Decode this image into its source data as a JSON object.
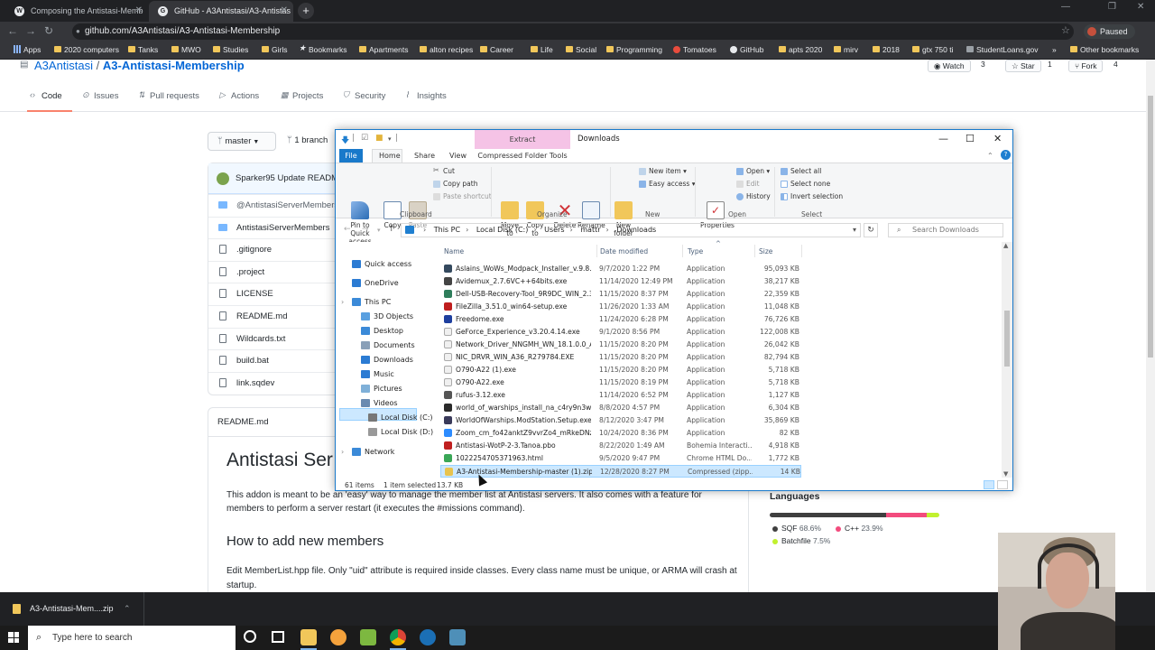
{
  "browser": {
    "tabs": [
      {
        "title": "Composing the Antistasi-Memb",
        "favicon": "W",
        "active": false
      },
      {
        "title": "GitHub - A3Antistasi/A3-Antistas",
        "favicon": "G",
        "active": true
      }
    ],
    "new_tab": "+",
    "url": "github.com/A3Antistasi/A3-Antistasi-Membership",
    "profile_status": "Paused",
    "bookmarks": [
      "Apps",
      "2020 computers",
      "Tanks",
      "MWO",
      "Studies",
      "Girls",
      "Bookmarks",
      "Apartments",
      "alton recipes",
      "Career",
      "Life",
      "Social",
      "Programming",
      "Tomatoes",
      "GitHub",
      "apts 2020",
      "mirv",
      "2018",
      "gtx 750 ti",
      "StudentLoans.gov"
    ],
    "bookmarks_more": "»",
    "other_bookmarks": "Other bookmarks"
  },
  "github": {
    "owner": "A3Antistasi",
    "separator": "/",
    "repo": "A3-Antistasi-Membership",
    "watch_label": "Watch",
    "watch_count": "3",
    "star_label": "Star",
    "star_count": "1",
    "fork_label": "Fork",
    "fork_count": "4",
    "tabs": [
      "Code",
      "Issues",
      "Pull requests",
      "Actions",
      "Projects",
      "Security",
      "Insights"
    ],
    "branch": "master",
    "branches": "1 branch",
    "commit": "Sparker95 Update READM",
    "files": [
      {
        "name": "@AntistasiServerMembers/",
        "type": "dir"
      },
      {
        "name": "AntistasiServerMembers",
        "type": "dir"
      },
      {
        "name": ".gitignore",
        "type": "file"
      },
      {
        "name": ".project",
        "type": "file"
      },
      {
        "name": "LICENSE",
        "type": "file"
      },
      {
        "name": "README.md",
        "type": "file"
      },
      {
        "name": "Wildcards.txt",
        "type": "file"
      },
      {
        "name": "build.bat",
        "type": "file"
      },
      {
        "name": "link.sqdev",
        "type": "file"
      }
    ],
    "readme": {
      "file": "README.md",
      "title": "Antistasi Ser",
      "intro": "This addon is meant to be an 'easy' way to manage the member list at Antistasi servers. It also comes with a feature for members to perform a server restart (it executes the #missions command).",
      "h2": "How to add new members",
      "p2": "Edit MemberList.hpp file. Only \"uid\" attribute is required inside classes. Every class name must be unique, or ARMA will crash at startup."
    },
    "languages": {
      "title": "Languages",
      "items": [
        {
          "name": "SQF",
          "percent": "68.6%",
          "value": 68.6,
          "color": "#3F3F3F"
        },
        {
          "name": "C++",
          "percent": "23.9%",
          "value": 23.9,
          "color": "#f34b7d"
        },
        {
          "name": "Batchfile",
          "percent": "7.5%",
          "value": 7.5,
          "color": "#C1F12E"
        }
      ]
    }
  },
  "explorer": {
    "title": "Downloads",
    "contextual_tab": "Extract",
    "ribbon_tabs": [
      "File",
      "Home",
      "Share",
      "View"
    ],
    "contextual_tab_label": "Compressed Folder Tools",
    "clipboard": {
      "pin": "Pin to Quick access",
      "copy": "Copy",
      "paste": "Paste",
      "cut": "Cut",
      "copy_path": "Copy path",
      "paste_shortcut": "Paste shortcut",
      "group": "Clipboard"
    },
    "organize": {
      "move_to": "Move to",
      "copy_to": "Copy to",
      "delete": "Delete",
      "rename": "Rename",
      "group": "Organize"
    },
    "new": {
      "new_folder": "New folder",
      "new_item": "New item",
      "easy_access": "Easy access",
      "group": "New"
    },
    "open": {
      "properties": "Properties",
      "open": "Open",
      "edit": "Edit",
      "history": "History",
      "group": "Open"
    },
    "select": {
      "select_all": "Select all",
      "select_none": "Select none",
      "invert": "Invert selection",
      "group": "Select"
    },
    "path": [
      "This PC",
      "Local Disk (C:)",
      "Users",
      "mattr",
      "Downloads"
    ],
    "search_placeholder": "Search Downloads",
    "nav": [
      {
        "label": "Quick access",
        "icon": "star-icon",
        "color": "#2b7bd3"
      },
      {
        "label": "OneDrive",
        "icon": "cloud-icon",
        "color": "#2b7bd3"
      },
      {
        "label": "This PC",
        "icon": "computer-icon",
        "color": "#3b8ad8"
      },
      {
        "label": "3D Objects",
        "icon": "cube-icon",
        "color": "#5aa0e0"
      },
      {
        "label": "Desktop",
        "icon": "desktop-icon",
        "color": "#3b8ad8"
      },
      {
        "label": "Documents",
        "icon": "documents-icon",
        "color": "#8aa0b8"
      },
      {
        "label": "Downloads",
        "icon": "download-icon",
        "color": "#2b7bd3"
      },
      {
        "label": "Music",
        "icon": "music-icon",
        "color": "#2b7bd3"
      },
      {
        "label": "Pictures",
        "icon": "pictures-icon",
        "color": "#7fb0d8"
      },
      {
        "label": "Videos",
        "icon": "videos-icon",
        "color": "#6a8ab0"
      },
      {
        "label": "Local Disk (C:)",
        "icon": "drive-icon",
        "color": "#777777"
      },
      {
        "label": "Local Disk (D:)",
        "icon": "drive-icon",
        "color": "#999999"
      },
      {
        "label": "Network",
        "icon": "network-icon",
        "color": "#3b8ad8"
      }
    ],
    "columns": [
      "Name",
      "Date modified",
      "Type",
      "Size"
    ],
    "files": [
      {
        "name": "Aslains_WoWs_Modpack_Installer_v.9.8.0...",
        "date": "9/7/2020 1:22 PM",
        "type": "Application",
        "size": "95,093 KB",
        "color": "#34495e"
      },
      {
        "name": "Avidemux_2.7.6VC++64bits.exe",
        "date": "11/14/2020 12:49 PM",
        "type": "Application",
        "size": "38,217 KB",
        "color": "#444444"
      },
      {
        "name": "Dell-USB-Recovery-Tool_9R9DC_WIN_2.3...",
        "date": "11/15/2020 8:37 PM",
        "type": "Application",
        "size": "22,359 KB",
        "color": "#2e7d5b"
      },
      {
        "name": "FileZilla_3.51.0_win64-setup.exe",
        "date": "11/26/2020 1:33 AM",
        "type": "Application",
        "size": "11,048 KB",
        "color": "#bf1e1e"
      },
      {
        "name": "Freedome.exe",
        "date": "11/24/2020 6:28 PM",
        "type": "Application",
        "size": "76,726 KB",
        "color": "#1e3f9e"
      },
      {
        "name": "GeForce_Experience_v3.20.4.14.exe",
        "date": "9/1/2020 8:56 PM",
        "type": "Application",
        "size": "122,008 KB",
        "color": "#f0f0f0"
      },
      {
        "name": "Network_Driver_NNGMH_WN_18.1.0.0_A...",
        "date": "11/15/2020 8:20 PM",
        "type": "Application",
        "size": "26,042 KB",
        "color": "#f0f0f0"
      },
      {
        "name": "NIC_DRVR_WIN_A36_R279784.EXE",
        "date": "11/15/2020 8:20 PM",
        "type": "Application",
        "size": "82,794 KB",
        "color": "#f0f0f0"
      },
      {
        "name": "O790-A22 (1).exe",
        "date": "11/15/2020 8:20 PM",
        "type": "Application",
        "size": "5,718 KB",
        "color": "#f0f0f0"
      },
      {
        "name": "O790-A22.exe",
        "date": "11/15/2020 8:19 PM",
        "type": "Application",
        "size": "5,718 KB",
        "color": "#f0f0f0"
      },
      {
        "name": "rufus-3.12.exe",
        "date": "11/14/2020 6:52 PM",
        "type": "Application",
        "size": "1,127 KB",
        "color": "#555555"
      },
      {
        "name": "world_of_warships_install_na_c4ry9n3w5...",
        "date": "8/8/2020 4:57 PM",
        "type": "Application",
        "size": "6,304 KB",
        "color": "#2a2a2a"
      },
      {
        "name": "WorldOfWarships.ModStation.Setup.exe",
        "date": "8/12/2020 3:47 PM",
        "type": "Application",
        "size": "35,869 KB",
        "color": "#3a3a5a"
      },
      {
        "name": "Zoom_cm_fo42anktZ9vvrZo4_mRkeDNzf...",
        "date": "10/24/2020 8:36 PM",
        "type": "Application",
        "size": "82 KB",
        "color": "#2d8cff"
      },
      {
        "name": "Antistasi-WotP-2-3.Tanoa.pbo",
        "date": "8/22/2020 1:49 AM",
        "type": "Bohemia Interacti...",
        "size": "4,918 KB",
        "color": "#c02020"
      },
      {
        "name": "1022254705371963.html",
        "date": "9/5/2020 9:47 PM",
        "type": "Chrome HTML Do...",
        "size": "1,772 KB",
        "color": "#3aa757"
      },
      {
        "name": "A3-Antistasi-Membership-master (1).zip",
        "date": "12/28/2020 8:27 PM",
        "type": "Compressed (zipp...",
        "size": "14 KB",
        "color": "#e8c34e",
        "selected": true
      }
    ],
    "status_items": "61 items",
    "status_selected": "1 item selected",
    "status_size": "13.7 KB"
  },
  "download_bar": {
    "file": "A3-Antistasi-Mem....zip"
  },
  "taskbar": {
    "search_placeholder": "Type here to search"
  }
}
